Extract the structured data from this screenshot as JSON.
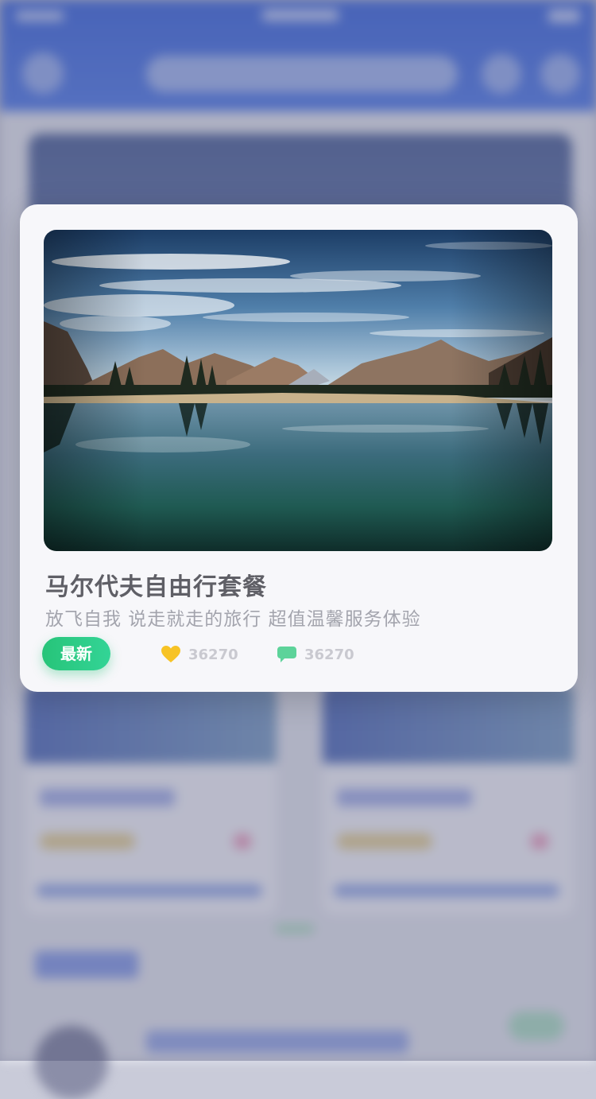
{
  "card": {
    "title": "马尔代夫自由行套餐",
    "subtitle": "放飞自我 说走就走的旅行 超值温馨服务体验",
    "tag": "最新",
    "likes": "36270",
    "comments": "36270",
    "image": "mountain-lake-landscape"
  },
  "colors": {
    "tag_green": "#27c479",
    "heart_yellow": "#f7c325",
    "comment_green": "#5dd39a",
    "header_blue": "#4a73e0"
  }
}
